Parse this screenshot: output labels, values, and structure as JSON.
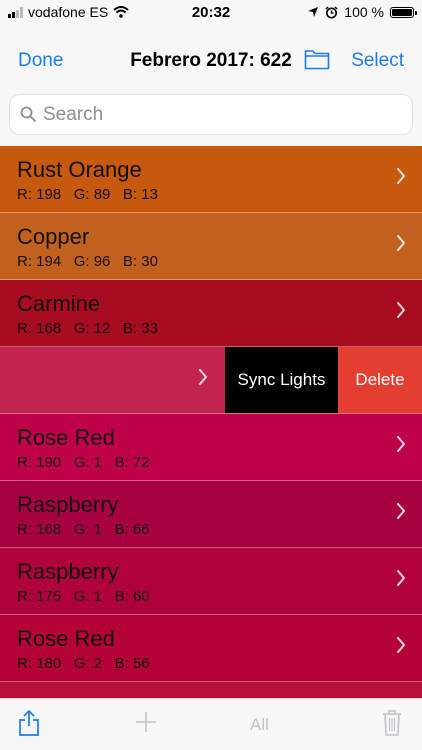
{
  "status_bar": {
    "carrier": "vodafone ES",
    "time": "20:32",
    "battery": "100 %"
  },
  "nav": {
    "done_label": "Done",
    "title": "Febrero 2017: 622",
    "select_label": "Select"
  },
  "search": {
    "placeholder": "Search"
  },
  "colors": {
    "accent": "#1b7cf0",
    "delete": "#e33e2f",
    "sync_lights_bg": "#000000"
  },
  "rows": [
    {
      "name": "Rust Orange",
      "r": "198",
      "g": "89",
      "b": "13",
      "hex": "#c6590d"
    },
    {
      "name": "Copper",
      "r": "194",
      "g": "96",
      "b": "30",
      "hex": "#c2601e"
    },
    {
      "name": "Carmine",
      "r": "168",
      "g": "12",
      "b": "33",
      "hex": "#a80c21"
    },
    {
      "name": "",
      "r": "",
      "g": "",
      "b": "",
      "hex": "#c3244f",
      "swiped": true
    },
    {
      "name": "Rose Red",
      "r": "190",
      "g": "1",
      "b": "72",
      "hex": "#be0148"
    },
    {
      "name": "Raspberry",
      "r": "168",
      "g": "1",
      "b": "66",
      "hex": "#a80142"
    },
    {
      "name": "Raspberry",
      "r": "175",
      "g": "1",
      "b": "60",
      "hex": "#af013c"
    },
    {
      "name": "Rose Red",
      "r": "180",
      "g": "2",
      "b": "56",
      "hex": "#b40238"
    },
    {
      "name": "",
      "r": "",
      "g": "",
      "b": "",
      "hex": "#b8123b"
    }
  ],
  "swipe_actions": {
    "sync_lights": "Sync Lights",
    "delete": "Delete"
  },
  "toolbar": {
    "all_label": "All"
  }
}
